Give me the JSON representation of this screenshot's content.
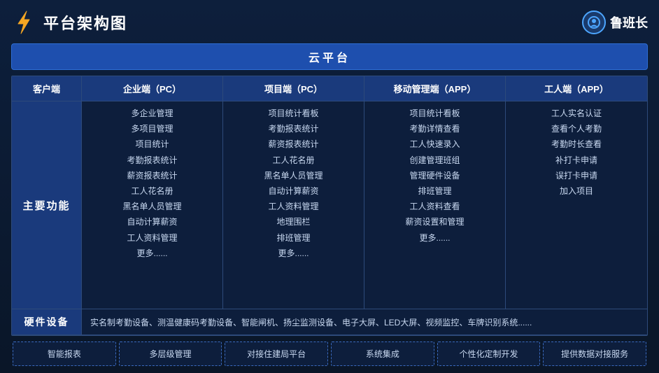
{
  "header": {
    "title": "平台架构图",
    "brand_name": "鲁班长"
  },
  "cloud_platform": {
    "label": "云平台"
  },
  "col_headers": [
    "客户端",
    "企业端（PC）",
    "项目端（PC）",
    "移动管理端（APP）",
    "工人端（APP）"
  ],
  "main_label": "主要功能",
  "columns": {
    "enterprise_pc": [
      "多企业管理",
      "多项目管理",
      "项目统计",
      "考勤报表统计",
      "薪资报表统计",
      "工人花名册",
      "黑名单人员管理",
      "自动计算薪资",
      "工人资料管理",
      "更多......"
    ],
    "project_pc": [
      "项目统计看板",
      "考勤报表统计",
      "薪资报表统计",
      "工人花名册",
      "黑名单人员管理",
      "自动计算薪资",
      "工人资料管理",
      "地理围栏",
      "排班管理",
      "更多......"
    ],
    "mobile_app": [
      "项目统计看板",
      "考勤详情查看",
      "工人快速录入",
      "创建管理班组",
      "管理硬件设备",
      "排班管理",
      "工人资料查看",
      "薪资设置和管理",
      "更多......"
    ],
    "worker_app": [
      "工人实名认证",
      "查看个人考勤",
      "考勤时长查看",
      "补打卡申请",
      "误打卡申请",
      "加入项目"
    ]
  },
  "hardware": {
    "label": "硬件设备",
    "content": "实名制考勤设备、测温健康码考勤设备、智能闸机、扬尘监测设备、电子大屏、LED大屏、视频监控、车牌识别系统......"
  },
  "bottom_items": [
    "智能报表",
    "多层级管理",
    "对接住建局平台",
    "系统集成",
    "个性化定制开发",
    "提供数据对接服务"
  ]
}
